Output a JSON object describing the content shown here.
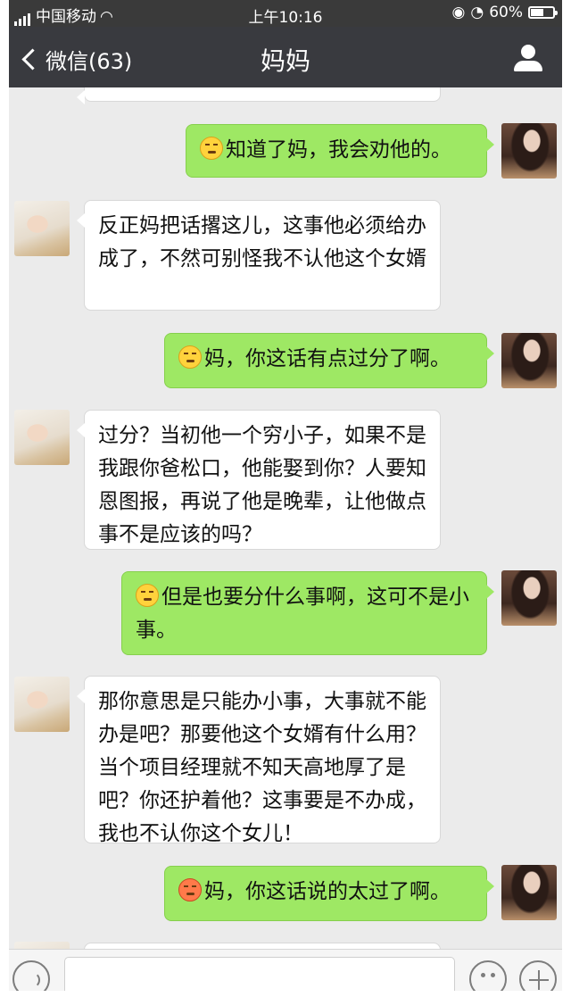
{
  "status_bar": {
    "carrier": "中国移动",
    "time": "上午10:16",
    "battery": "60%",
    "battery_level": 0.6
  },
  "nav": {
    "back_label": "微信(63)",
    "title": "妈妈"
  },
  "messages": [
    {
      "from": "me",
      "emoji": "relieved-face",
      "text": "知道了妈，我会劝他的。"
    },
    {
      "from": "mom",
      "text": "反正妈把话撂这儿，这事他必须给办成了，不然可别怪我不认他这个女婿"
    },
    {
      "from": "me",
      "emoji": "relieved-face",
      "text": "妈，你这话有点过分了啊。"
    },
    {
      "from": "mom",
      "text": "过分？当初他一个穷小子，如果不是我跟你爸松口，他能娶到你？人要知恩图报，再说了他是晚辈，让他做点事不是应该的吗？"
    },
    {
      "from": "me",
      "emoji": "relieved-face",
      "text": "但是也要分什么事啊，这可不是小事。"
    },
    {
      "from": "mom",
      "text": "那你意思是只能办小事，大事就不能办是吧？那要他这个女婿有什么用？当个项目经理就不知天高地厚了是吧？你还护着他？这事要是不办成，我也不认你这个女儿！"
    },
    {
      "from": "me",
      "emoji": "flushed-face",
      "text": "妈，你这话说的太过了啊。"
    }
  ],
  "colors": {
    "outgoing_bubble": "#9ee864",
    "incoming_bubble": "#ffffff",
    "nav_bg": "#393a3f",
    "chat_bg": "#ebebeb"
  }
}
